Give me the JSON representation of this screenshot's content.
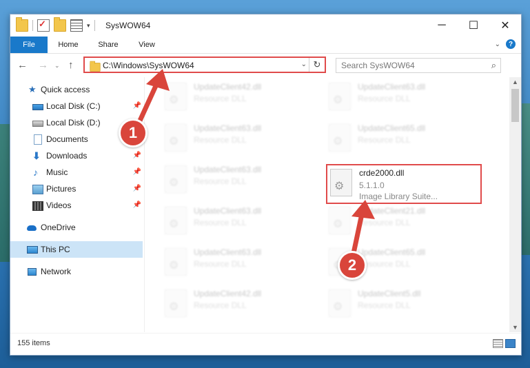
{
  "window": {
    "title": "SysWOW64",
    "controls": {
      "minimize": "─",
      "maximize": "☐",
      "close": "✕"
    }
  },
  "ribbon": {
    "tabs": [
      "File",
      "Home",
      "Share",
      "View"
    ],
    "help": "?"
  },
  "navigation": {
    "address": "C:\\Windows\\SysWOW64",
    "search_placeholder": "Search SysWOW64"
  },
  "sidebar": {
    "items": [
      {
        "label": "Quick access",
        "icon": "star-icon"
      },
      {
        "label": "Local Disk (C:)",
        "icon": "disk-icon"
      },
      {
        "label": "Local Disk (D:)",
        "icon": "disk-icon"
      },
      {
        "label": "Documents",
        "icon": "documents-icon"
      },
      {
        "label": "Downloads",
        "icon": "downloads-icon"
      },
      {
        "label": "Music",
        "icon": "music-icon"
      },
      {
        "label": "Pictures",
        "icon": "pictures-icon"
      },
      {
        "label": "Videos",
        "icon": "videos-icon"
      },
      {
        "label": "OneDrive",
        "icon": "onedrive-icon"
      },
      {
        "label": "This PC",
        "icon": "pc-icon",
        "selected": true
      },
      {
        "label": "Network",
        "icon": "network-icon"
      }
    ]
  },
  "files": {
    "left_column": [
      {
        "name": "UpdateClient42.dll",
        "type": "Resource DLL"
      },
      {
        "name": "UpdateClient63.dll",
        "type": "Resource DLL"
      },
      {
        "name": "UpdateClient63.dll",
        "type": "Resource DLL"
      },
      {
        "name": "UpdateClient63.dll",
        "type": "Resource DLL"
      },
      {
        "name": "UpdateClient63.dll",
        "type": "Resource DLL"
      },
      {
        "name": "UpdateClient42.dll",
        "type": "Resource DLL"
      }
    ],
    "right_column": [
      {
        "name": "UpdateClient63.dll",
        "type": "Resource DLL"
      },
      {
        "name": "UpdateClient65.dll",
        "type": "Resource DLL"
      },
      {
        "name": "crde2000.dll",
        "version": "5.1.1.0",
        "description": "Image Library Suite...",
        "highlighted": true
      },
      {
        "name": "UpdateClient21.dll",
        "type": "Resource DLL"
      },
      {
        "name": "UpdateClient65.dll",
        "type": "Resource DLL"
      },
      {
        "name": "UpdateClient5.dll",
        "type": "Resource DLL"
      }
    ]
  },
  "status": {
    "item_count": "155 items"
  },
  "annotations": {
    "step1": "1",
    "step2": "2"
  },
  "colors": {
    "highlight": "#e04a4a",
    "accent": "#1979ca",
    "selected": "#cce4f7"
  }
}
